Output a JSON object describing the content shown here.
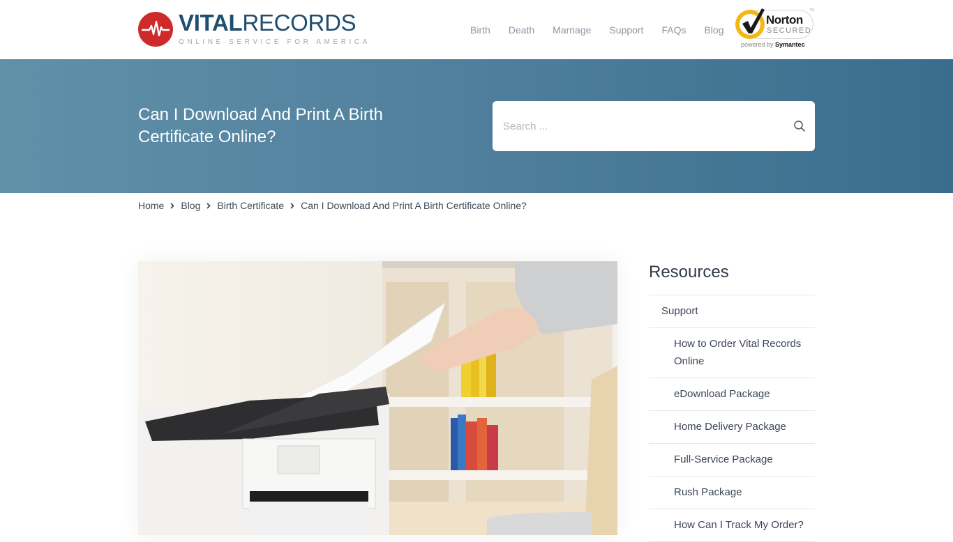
{
  "brand": {
    "name_bold": "VITAL",
    "name_light": "RECORDS",
    "tagline": "ONLINE SERVICE FOR AMERICA",
    "logo_icon": "heartbeat-icon",
    "colors": {
      "logo_red": "#cf2a2a",
      "logo_navy": "#1f4e6e"
    }
  },
  "nav": {
    "items": [
      {
        "label": "Birth"
      },
      {
        "label": "Death"
      },
      {
        "label": "Marriage"
      },
      {
        "label": "Support"
      },
      {
        "label": "FAQs"
      },
      {
        "label": "Blog"
      }
    ]
  },
  "trust_badge": {
    "brand": "Norton",
    "status": "SECURED",
    "powered_prefix": "powered by",
    "powered_brand": "Symantec",
    "tm": "TM"
  },
  "hero": {
    "title": "Can I Download And Print A Birth Certificate Online?",
    "gradient": [
      "#6190a9",
      "#3a6d8d"
    ],
    "search": {
      "placeholder": "Search ...",
      "value": "",
      "icon": "search-icon"
    }
  },
  "breadcrumb": {
    "items": [
      {
        "label": "Home"
      },
      {
        "label": "Blog"
      },
      {
        "label": "Birth Certificate"
      },
      {
        "label": "Can I Download And Print A Birth Certificate Online?"
      }
    ]
  },
  "featured_image": {
    "alt": "Hand taking a printed sheet from a laser printer"
  },
  "sidebar": {
    "title": "Resources",
    "items": [
      {
        "label": "Support",
        "level": 1
      },
      {
        "label": "How to Order Vital Records Online",
        "level": 2
      },
      {
        "label": "eDownload Package",
        "level": 2
      },
      {
        "label": "Home Delivery Package",
        "level": 2
      },
      {
        "label": "Full-Service Package",
        "level": 2
      },
      {
        "label": "Rush Package",
        "level": 2
      },
      {
        "label": "How Can I Track My Order?",
        "level": 2
      }
    ]
  }
}
